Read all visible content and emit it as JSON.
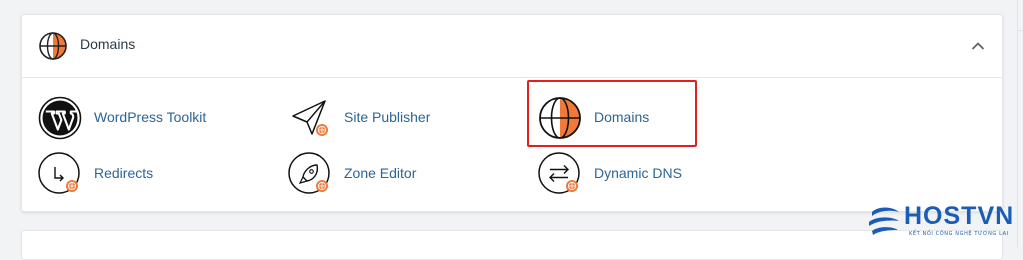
{
  "section": {
    "title": "Domains",
    "icon": "globe-icon",
    "collapse_icon": "chevron-up-icon"
  },
  "tools": [
    {
      "label": "WordPress Toolkit",
      "icon": "wordpress-icon"
    },
    {
      "label": "Site Publisher",
      "icon": "paper-plane-icon"
    },
    {
      "label": "Domains",
      "icon": "globe-icon"
    },
    {
      "label": "Redirects",
      "icon": "redirect-arrow-icon"
    },
    {
      "label": "Zone Editor",
      "icon": "rocket-icon"
    },
    {
      "label": "Dynamic DNS",
      "icon": "swap-arrows-icon"
    }
  ],
  "watermark": {
    "brand": "HOSTVN",
    "tagline": "KẾT NỐI CÔNG NGHỆ TƯƠNG LAI"
  },
  "colors": {
    "accent_orange": "#f07a3a",
    "link_blue": "#2d6496",
    "highlight_red": "#e02020",
    "brand_blue": "#1a5db4"
  }
}
